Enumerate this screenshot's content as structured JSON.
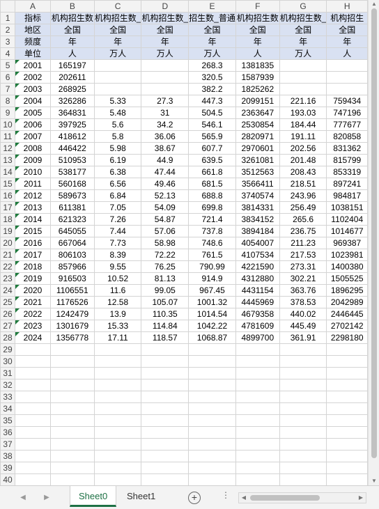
{
  "columns": [
    "A",
    "B",
    "C",
    "D",
    "E",
    "F",
    "G",
    "H"
  ],
  "header_rows": [
    [
      "指标",
      "机构招生数",
      "机构招生数_",
      "机构招生数_",
      "招生数_普通",
      "机构招生数",
      "机构招生数_",
      "机构招生"
    ],
    [
      "地区",
      "全国",
      "全国",
      "全国",
      "全国",
      "全国",
      "全国",
      "全国"
    ],
    [
      "频度",
      "年",
      "年",
      "年",
      "年",
      "年",
      "年",
      "年"
    ],
    [
      "单位",
      "人",
      "万人",
      "万人",
      "万人",
      "人",
      "万人",
      "人"
    ]
  ],
  "data_rows": [
    [
      "2001",
      "165197",
      "",
      "",
      "268.3",
      "1381835",
      "",
      ""
    ],
    [
      "2002",
      "202611",
      "",
      "",
      "320.5",
      "1587939",
      "",
      ""
    ],
    [
      "2003",
      "268925",
      "",
      "",
      "382.2",
      "1825262",
      "",
      ""
    ],
    [
      "2004",
      "326286",
      "5.33",
      "27.3",
      "447.3",
      "2099151",
      "221.16",
      "759434"
    ],
    [
      "2005",
      "364831",
      "5.48",
      "31",
      "504.5",
      "2363647",
      "193.03",
      "747196"
    ],
    [
      "2006",
      "397925",
      "5.6",
      "34.2",
      "546.1",
      "2530854",
      "184.44",
      "777677"
    ],
    [
      "2007",
      "418612",
      "5.8",
      "36.06",
      "565.9",
      "2820971",
      "191.11",
      "820858"
    ],
    [
      "2008",
      "446422",
      "5.98",
      "38.67",
      "607.7",
      "2970601",
      "202.56",
      "831362"
    ],
    [
      "2009",
      "510953",
      "6.19",
      "44.9",
      "639.5",
      "3261081",
      "201.48",
      "815799"
    ],
    [
      "2010",
      "538177",
      "6.38",
      "47.44",
      "661.8",
      "3512563",
      "208.43",
      "853319"
    ],
    [
      "2011",
      "560168",
      "6.56",
      "49.46",
      "681.5",
      "3566411",
      "218.51",
      "897241"
    ],
    [
      "2012",
      "589673",
      "6.84",
      "52.13",
      "688.8",
      "3740574",
      "243.96",
      "984817"
    ],
    [
      "2013",
      "611381",
      "7.05",
      "54.09",
      "699.8",
      "3814331",
      "256.49",
      "1038151"
    ],
    [
      "2014",
      "621323",
      "7.26",
      "54.87",
      "721.4",
      "3834152",
      "265.6",
      "1102404"
    ],
    [
      "2015",
      "645055",
      "7.44",
      "57.06",
      "737.8",
      "3894184",
      "236.75",
      "1014677"
    ],
    [
      "2016",
      "667064",
      "7.73",
      "58.98",
      "748.6",
      "4054007",
      "211.23",
      "969387"
    ],
    [
      "2017",
      "806103",
      "8.39",
      "72.22",
      "761.5",
      "4107534",
      "217.53",
      "1023981"
    ],
    [
      "2018",
      "857966",
      "9.55",
      "76.25",
      "790.99",
      "4221590",
      "273.31",
      "1400380"
    ],
    [
      "2019",
      "916503",
      "10.52",
      "81.13",
      "914.9",
      "4312880",
      "302.21",
      "1505525"
    ],
    [
      "2020",
      "1106551",
      "11.6",
      "99.05",
      "967.45",
      "4431154",
      "363.76",
      "1896295"
    ],
    [
      "2021",
      "1176526",
      "12.58",
      "105.07",
      "1001.32",
      "4445969",
      "378.53",
      "2042989"
    ],
    [
      "2022",
      "1242479",
      "13.9",
      "110.35",
      "1014.54",
      "4679358",
      "440.02",
      "2446445"
    ],
    [
      "2023",
      "1301679",
      "15.33",
      "114.84",
      "1042.22",
      "4781609",
      "445.49",
      "2702142"
    ],
    [
      "2024",
      "1356778",
      "17.11",
      "118.57",
      "1068.87",
      "4899700",
      "361.91",
      "2298180"
    ]
  ],
  "total_rows": 40,
  "tabs": [
    {
      "label": "Sheet0",
      "active": true
    },
    {
      "label": "Sheet1",
      "active": false
    }
  ],
  "tabbar": {
    "add_icon": "plus-circle-icon",
    "more": "⋮"
  },
  "colors": {
    "header_fill": "#d9e1f2",
    "active_tab": "#1e7145",
    "error_marker": "#1f7a3d"
  }
}
